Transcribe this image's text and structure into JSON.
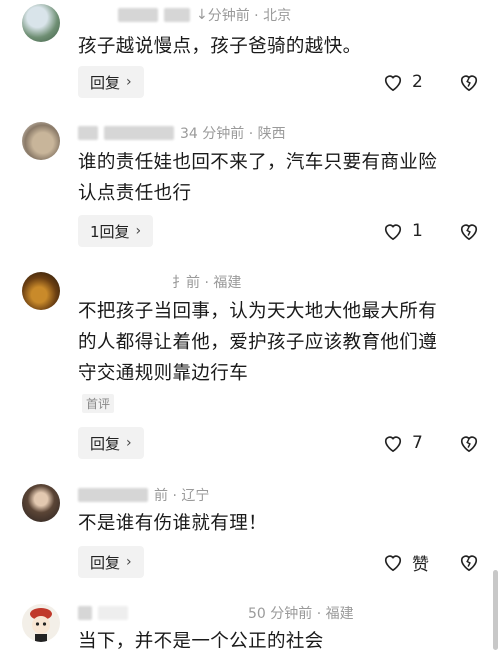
{
  "comments": [
    {
      "time_location": "分钟前 · 北京",
      "time_partial": "↓",
      "text_lines": [
        "孩子越说慢点，孩子爸骑的越快。"
      ],
      "reply_label": "回复",
      "like_count": "2"
    },
    {
      "time_location": "34 分钟前 · 陕西",
      "text_lines": [
        "谁的责任娃也回不来了，汽车只要有商业险",
        "认点责任也行"
      ],
      "reply_label": "1回复",
      "like_count": "1"
    },
    {
      "time_location": "前 · 福建",
      "time_partial": "扌",
      "text_lines": [
        "不把孩子当回事，认为天大地大他最大所有",
        "的人都得让着他，爱护孩子应该教育他们遵",
        "守交通规则靠边行车"
      ],
      "tag": "首评",
      "reply_label": "回复",
      "like_count": "7"
    },
    {
      "time_location": "前 · 辽宁",
      "text_lines": [
        "不是谁有伤谁就有理！"
      ],
      "reply_label": "回复",
      "like_count": "赞"
    },
    {
      "time_location": "50 分钟前 · 福建",
      "text_lines": [
        "当下，并不是一个公正的社会"
      ]
    }
  ],
  "icons": {
    "like": "heart-outline-icon",
    "dislike": "broken-heart-icon",
    "chevron": "chevron-right-icon"
  },
  "colors": {
    "text": "#1a1a1a",
    "meta": "#9a9a9a",
    "button_bg": "#f2f2f2"
  }
}
